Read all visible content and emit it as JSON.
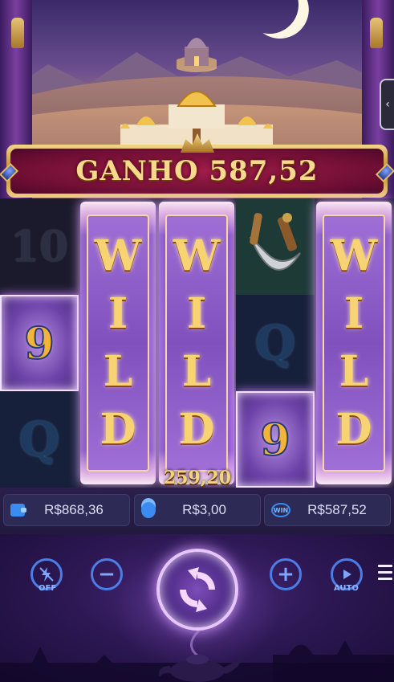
{
  "banner": {
    "label": "GANHO 587,52"
  },
  "reels": {
    "reel1": {
      "top": "10",
      "middle": "9",
      "bottom": "Q"
    },
    "reel2": {
      "letters": [
        "W",
        "I",
        "L",
        "D"
      ]
    },
    "reel3": {
      "letters": [
        "W",
        "I",
        "L",
        "D"
      ],
      "win_amount": "259,20"
    },
    "reel4": {
      "middle": "Q",
      "bottom": "9"
    },
    "reel5": {
      "letters": [
        "W",
        "I",
        "L",
        "D"
      ]
    }
  },
  "info": {
    "balance": "R$868,36",
    "bet": "R$3,00",
    "win": "R$587,52",
    "win_icon_text": "WIN"
  },
  "controls": {
    "turbo_label": "OFF",
    "auto_label": "AUTO",
    "minus_glyph": "−",
    "plus_glyph": "+"
  },
  "side_tab": {
    "glyph": "‹"
  },
  "colors": {
    "banner_gold": "#f6d98c",
    "banner_red": "#a21d4a",
    "control_blue": "#4d7de6",
    "wild_purple": "#8a58c9"
  }
}
